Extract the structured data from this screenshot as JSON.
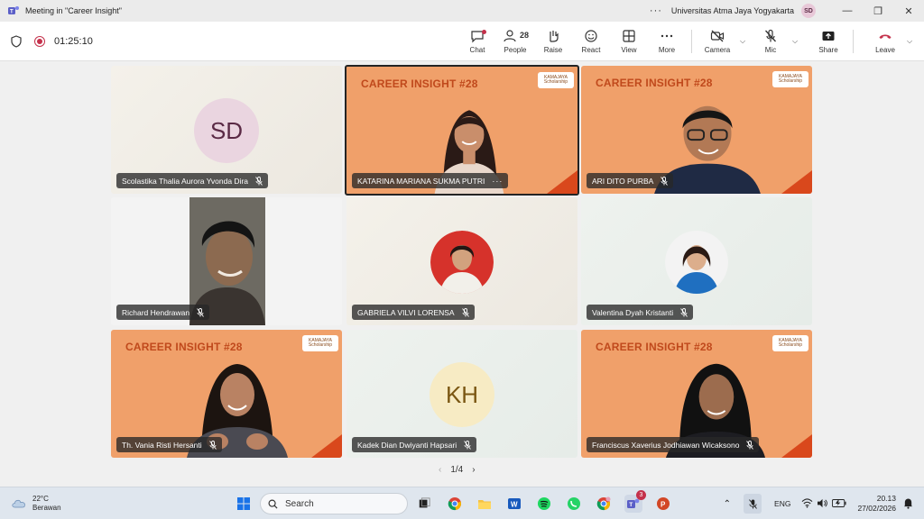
{
  "window": {
    "title": "Meeting in \"Career Insight\"",
    "organization": "Universitas Atma Jaya Yogyakarta",
    "user_initials": "SD",
    "minimize": "—",
    "restore": "❐",
    "close": "✕"
  },
  "toolbar": {
    "timer": "01:25:10",
    "chat_label": "Chat",
    "people_label": "People",
    "people_count": "28",
    "raise_label": "Raise",
    "react_label": "React",
    "view_label": "View",
    "more_label": "More",
    "camera_label": "Camera",
    "mic_label": "Mic",
    "share_label": "Share",
    "leave_label": "Leave"
  },
  "banner": {
    "career_insight": "CAREER INSIGHT #28",
    "logo_text": "KAMAJAYA Scholarship"
  },
  "participants": [
    {
      "name": "Scolastika Thalia Aurora Yvonda Dira",
      "initials": "SD"
    },
    {
      "name": "KATARINA MARIANA SUKMA PUTRI"
    },
    {
      "name": "ARI DITO PURBA"
    },
    {
      "name": "Richard Hendrawan"
    },
    {
      "name": "GABRIELA VILVI LORENSA"
    },
    {
      "name": "Valentina Dyah Kristanti"
    },
    {
      "name": "Th. Vania Risti Hersanti"
    },
    {
      "name": "Kadek Dian Dwiyanti Hapsari",
      "initials": "KH"
    },
    {
      "name": "Franciscus Xaverius Jodhiawan Wicaksono"
    }
  ],
  "pager": {
    "text": "1/4"
  },
  "taskbar": {
    "weather_temp": "22°C",
    "weather_desc": "Berawan",
    "search_placeholder": "Search",
    "teams_badge": "3",
    "language": "ENG",
    "time": "20.13",
    "date": "27/02/2026"
  },
  "colors": {
    "banner_orange": "#f0a06a",
    "banner_text": "#c0491c",
    "leave_red": "#c4314b"
  }
}
